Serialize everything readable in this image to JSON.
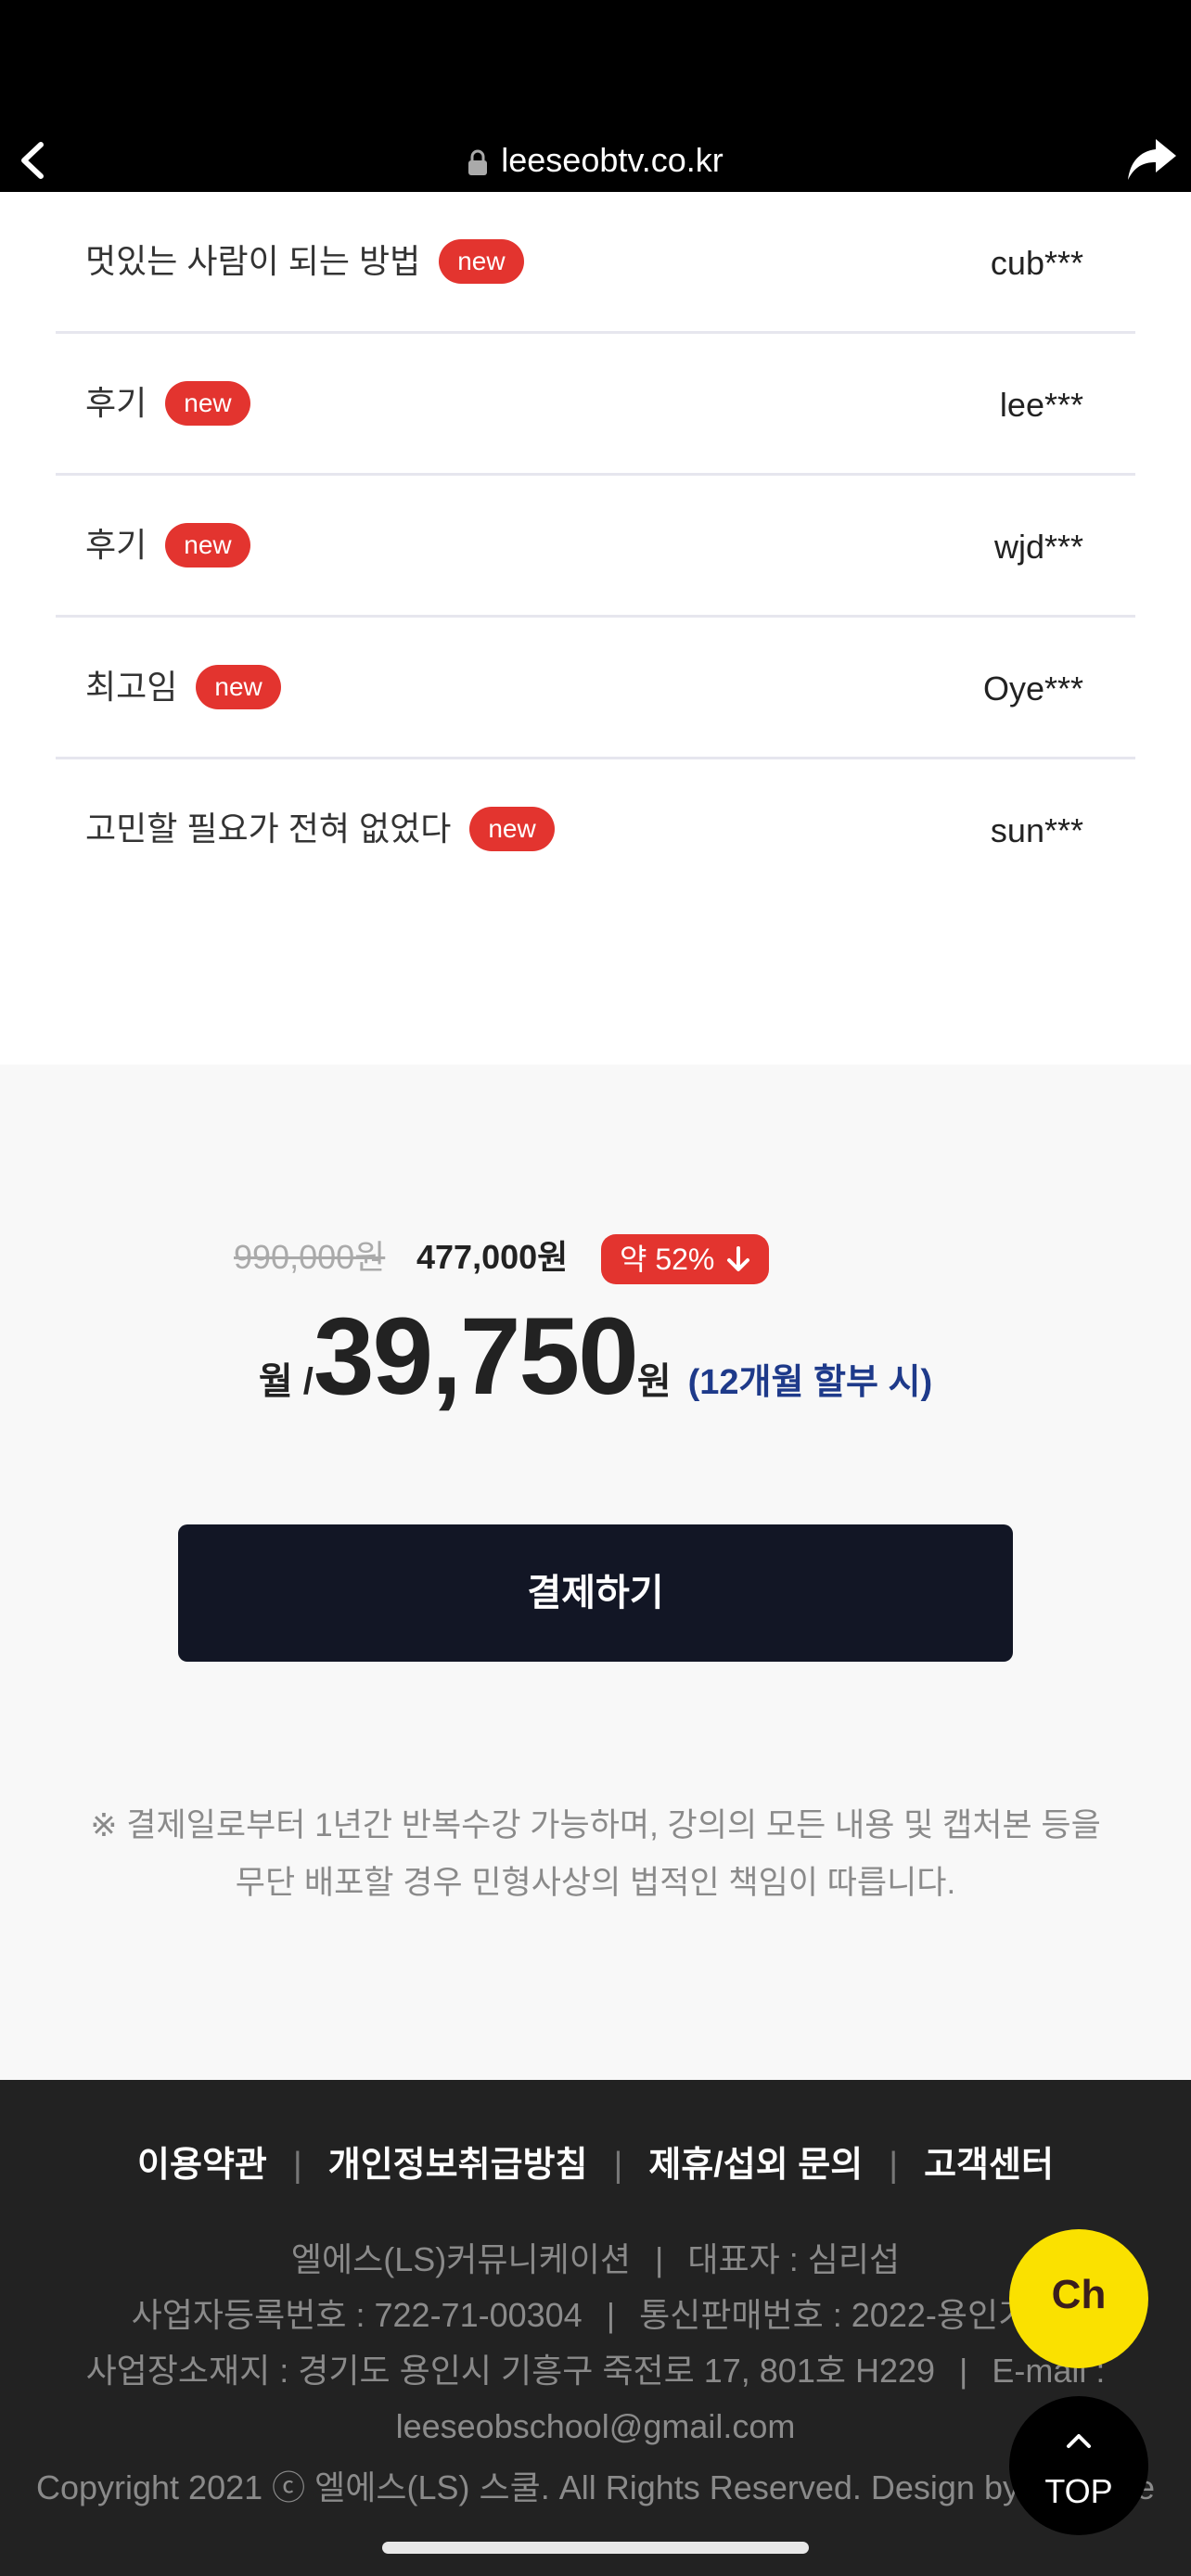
{
  "browser": {
    "url": "leeseobtv.co.kr",
    "icons": {
      "back": "chevron-left-icon",
      "lock": "lock-icon",
      "share": "share-icon"
    }
  },
  "reviews": [
    {
      "title": "멋있는 사람이 되는 방법",
      "badge": "new",
      "user": "cub***"
    },
    {
      "title": "후기",
      "badge": "new",
      "user": "lee***"
    },
    {
      "title": "후기",
      "badge": "new",
      "user": "wjd***"
    },
    {
      "title": "최고임",
      "badge": "new",
      "user": "Oye***"
    },
    {
      "title": "고민할 필요가 전혀 없었다",
      "badge": "new",
      "user": "sun***"
    }
  ],
  "price": {
    "original": "990,000원",
    "sale": "477,000원",
    "discount": "약 52%",
    "monthly_label": "월 /",
    "monthly_amount": "39,750",
    "monthly_unit": "원",
    "installment_note": "(12개월 할부 시)",
    "pay_button": "결제하기",
    "notice_line1": "※ 결제일로부터 1년간 반복수강 가능하며, 강의의 모든 내용 및 캡처본 등을",
    "notice_line2": "무단 배포할 경우 민형사상의 법적인 책임이 따릅니다."
  },
  "footer": {
    "links": [
      "이용약관",
      "개인정보취급방침",
      "제휴/섭외 문의",
      "고객센터"
    ],
    "separator": "|",
    "company": "엘에스(LS)커뮤니케이션",
    "ceo": "대표자 : 심리섭",
    "business_no": "사업자등록번호 : 722-71-00304",
    "mail_order_no": "통신판매번호 : 2022-용인기흥",
    "address": "사업장소재지 : 경기도 용인시 기흥구 죽전로 17, 801호 H229",
    "email_label": "E-mail :",
    "email": "leeseobschool@gmail.com",
    "copyright": "Copyright 2021 ⓒ 엘에스(LS) 스쿨. All Rights Reserved. Design by NFtcube"
  },
  "floating": {
    "channel_label": "Ch",
    "top_label": "TOP"
  },
  "colors": {
    "badge": "#e3342f",
    "pay_button": "#121625",
    "installment": "#1e3a8a",
    "kakao": "#fae100",
    "footer_bg": "#222222"
  }
}
